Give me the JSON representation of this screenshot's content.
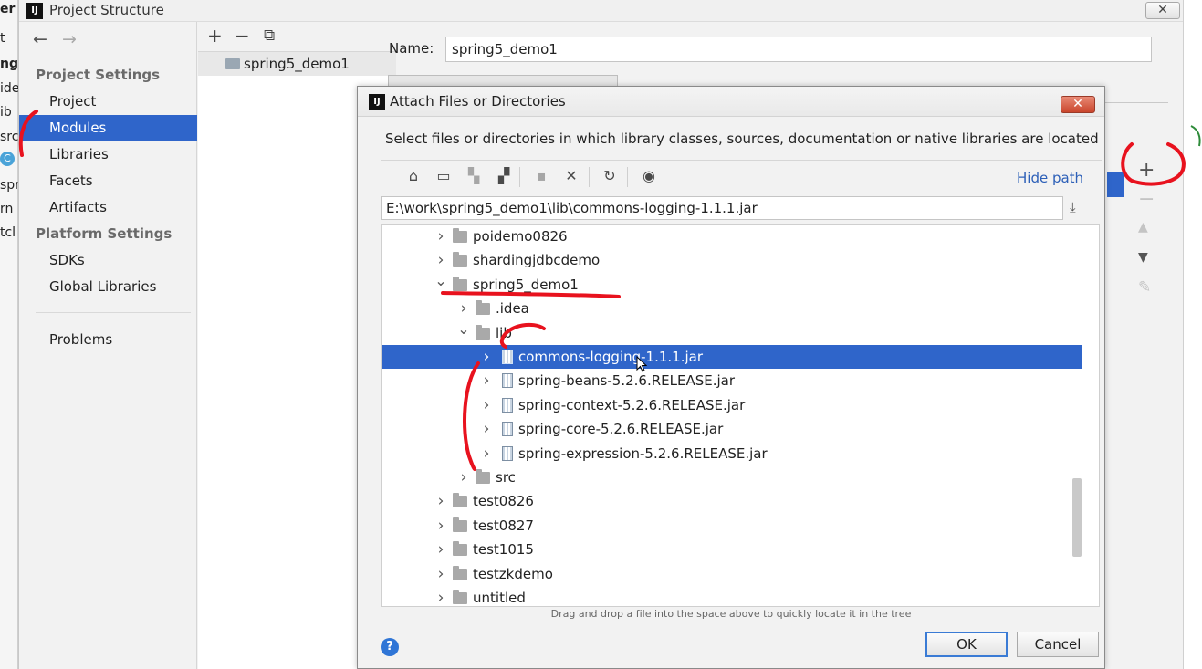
{
  "edge_text": [
    "er",
    "t",
    "ng",
    "ide",
    "ib",
    "src",
    "spr",
    "rn",
    "tcl"
  ],
  "main_window": {
    "title": "Project Structure",
    "close_glyph": "✕"
  },
  "nav": {
    "back_glyph": "←",
    "forward_glyph": "→",
    "project_settings_header": "Project Settings",
    "platform_settings_header": "Platform Settings",
    "items": {
      "project": "Project",
      "modules": "Modules",
      "libraries": "Libraries",
      "facets": "Facets",
      "artifacts": "Artifacts",
      "sdks": "SDKs",
      "global_libraries": "Global Libraries",
      "problems": "Problems"
    },
    "selected": "Modules"
  },
  "module_list": {
    "add_glyph": "+",
    "remove_glyph": "−",
    "copy_glyph": "⧉",
    "items": [
      "spring5_demo1"
    ]
  },
  "details": {
    "name_label": "Name:",
    "name_value": "spring5_demo1"
  },
  "right_toolbar": {
    "add_glyph": "+",
    "remove_glyph": "−",
    "up_glyph": "▲",
    "down_glyph": "▼",
    "edit_glyph": "✎"
  },
  "dialog": {
    "title": "Attach Files or Directories",
    "close_glyph": "✕",
    "description": "Select files or directories in which library classes, sources, documentation or native libraries are located",
    "toolbar": {
      "home_glyph": "⌂",
      "desktop_glyph": "▭",
      "new_folder_glyph": "▚",
      "folder2_glyph": "▞",
      "move_glyph": "▪",
      "delete_glyph": "✕",
      "refresh_glyph": "↻",
      "show_hidden_glyph": "◉"
    },
    "hide_path_label": "Hide path",
    "path_value": "E:\\work\\spring5_demo1\\lib\\commons-logging-1.1.1.jar",
    "download_glyph": "⤓",
    "tree": [
      {
        "label": "poidemo0826",
        "depth": 0,
        "expanded": false,
        "kind": "folder",
        "selected": false
      },
      {
        "label": "shardingjdbcdemo",
        "depth": 0,
        "expanded": false,
        "kind": "folder",
        "selected": false
      },
      {
        "label": "spring5_demo1",
        "depth": 0,
        "expanded": true,
        "kind": "folder",
        "selected": false
      },
      {
        "label": ".idea",
        "depth": 1,
        "expanded": false,
        "kind": "folder",
        "selected": false
      },
      {
        "label": "lib",
        "depth": 1,
        "expanded": true,
        "kind": "folder",
        "selected": false
      },
      {
        "label": "commons-logging-1.1.1.jar",
        "depth": 2,
        "expanded": false,
        "kind": "jar",
        "selected": true
      },
      {
        "label": "spring-beans-5.2.6.RELEASE.jar",
        "depth": 2,
        "expanded": false,
        "kind": "jar",
        "selected": false
      },
      {
        "label": "spring-context-5.2.6.RELEASE.jar",
        "depth": 2,
        "expanded": false,
        "kind": "jar",
        "selected": false
      },
      {
        "label": "spring-core-5.2.6.RELEASE.jar",
        "depth": 2,
        "expanded": false,
        "kind": "jar",
        "selected": false
      },
      {
        "label": "spring-expression-5.2.6.RELEASE.jar",
        "depth": 2,
        "expanded": false,
        "kind": "jar",
        "selected": false
      },
      {
        "label": "src",
        "depth": 1,
        "expanded": false,
        "kind": "folder",
        "selected": false
      },
      {
        "label": "test0826",
        "depth": 0,
        "expanded": false,
        "kind": "folder",
        "selected": false
      },
      {
        "label": "test0827",
        "depth": 0,
        "expanded": false,
        "kind": "folder",
        "selected": false
      },
      {
        "label": "test1015",
        "depth": 0,
        "expanded": false,
        "kind": "folder",
        "selected": false
      },
      {
        "label": "testzkdemo",
        "depth": 0,
        "expanded": false,
        "kind": "folder",
        "selected": false
      },
      {
        "label": "untitled",
        "depth": 0,
        "expanded": false,
        "kind": "folder",
        "selected": false
      }
    ],
    "drag_hint": "Drag and drop a file into the space above to quickly locate it in the tree",
    "help_glyph": "?",
    "ok_label": "OK",
    "cancel_label": "Cancel"
  },
  "colors": {
    "selection": "#2f65ca",
    "annotation": "#e8121e",
    "link": "#2d60b8"
  }
}
